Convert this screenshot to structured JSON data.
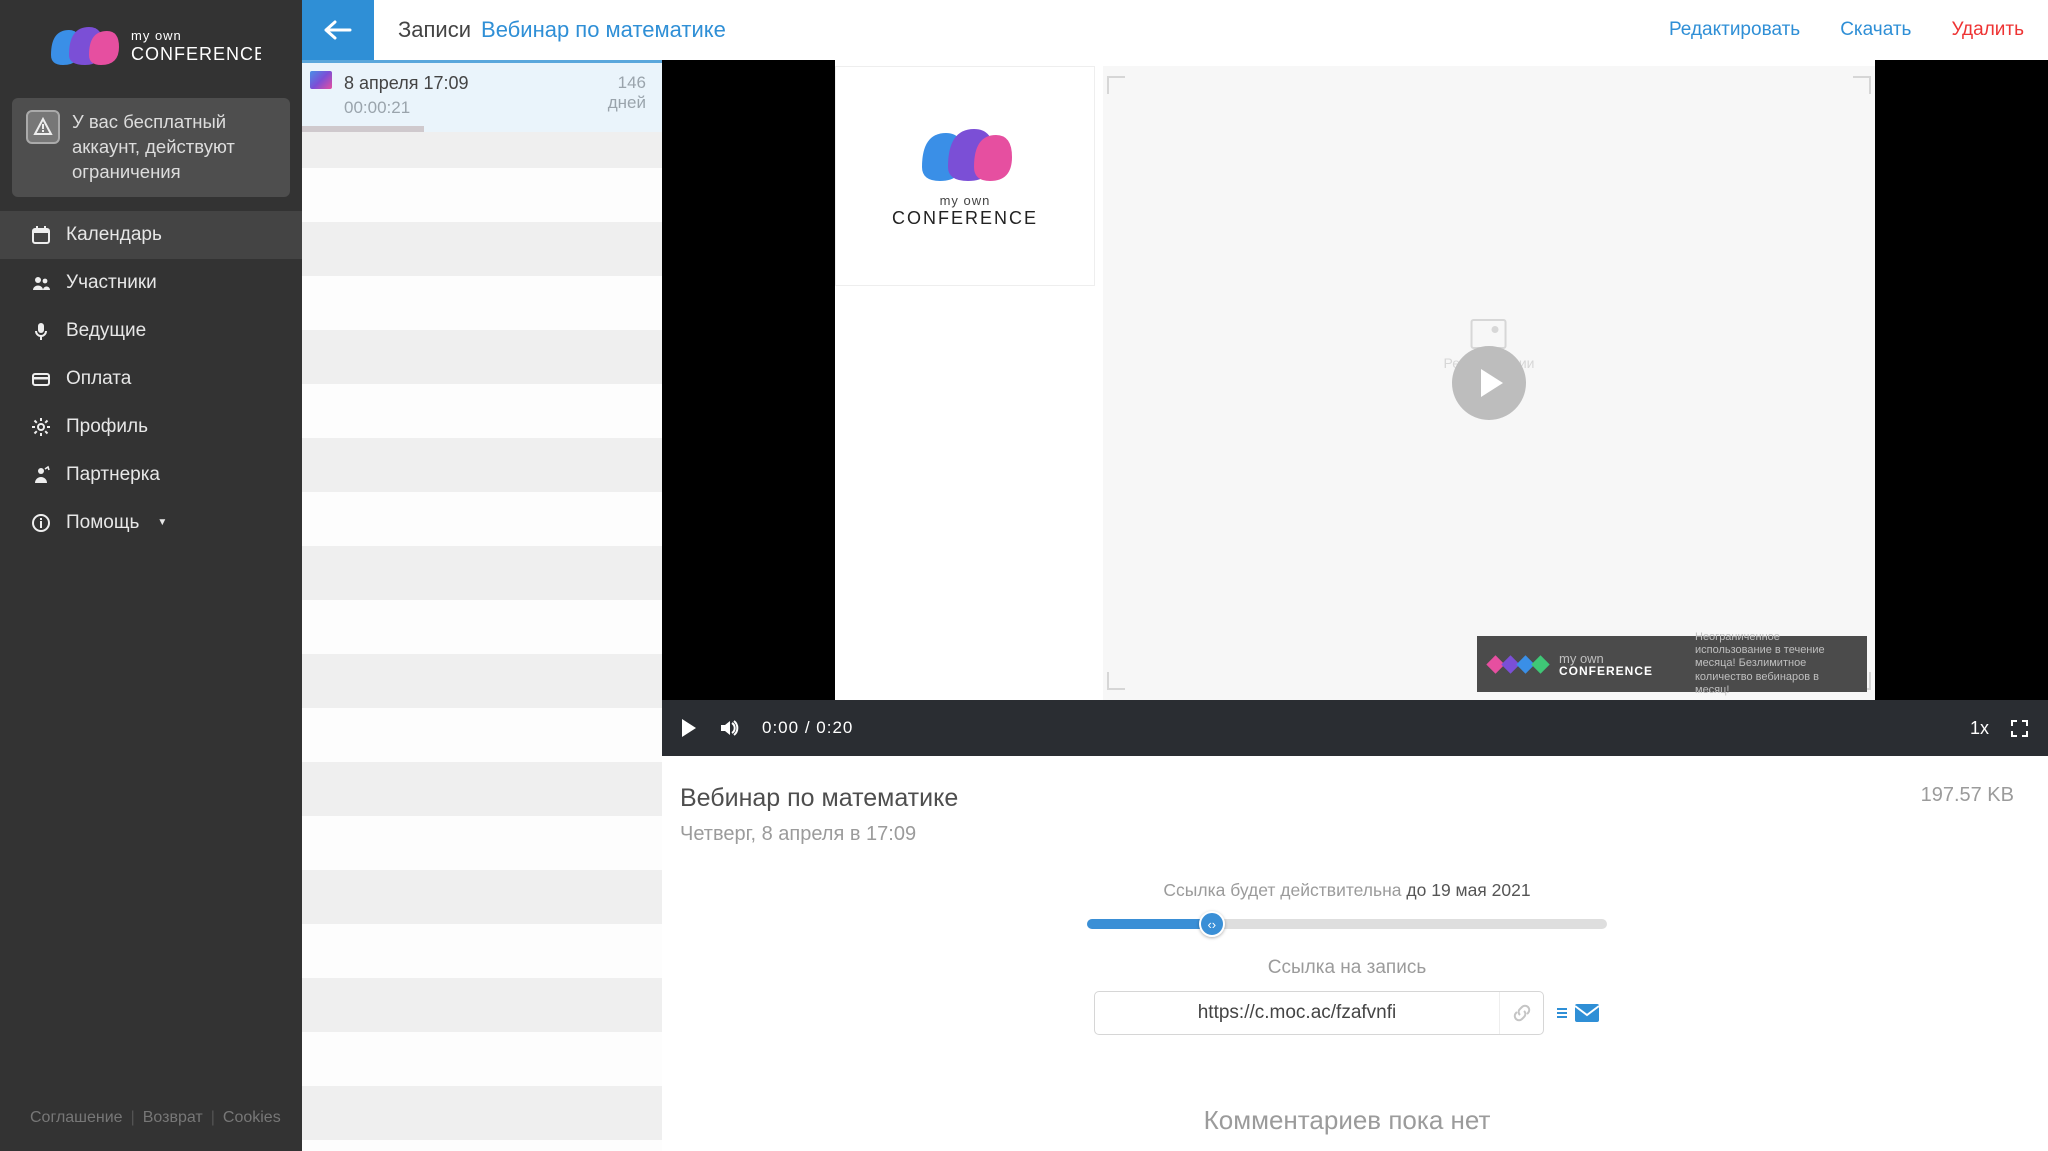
{
  "brand": {
    "line1": "my own",
    "line2": "CONFERENCE"
  },
  "notice": "У вас бесплатный аккаунт, действуют ограничения",
  "nav": {
    "calendar": "Календарь",
    "participants": "Участники",
    "hosts": "Ведущие",
    "payment": "Оплата",
    "profile": "Профиль",
    "affiliate": "Партнерка",
    "help": "Помощь"
  },
  "footer": {
    "agreement": "Соглашение",
    "refund": "Возврат",
    "cookies": "Cookies"
  },
  "crumb": {
    "label": "Записи",
    "link": "Вебинар по математике"
  },
  "actions": {
    "edit": "Редактировать",
    "download": "Скачать",
    "delete": "Удалить"
  },
  "listItem": {
    "date": "8 апреля 17:09",
    "duration": "00:00:21",
    "daysN": "146",
    "daysL": "дней"
  },
  "player": {
    "current": "0:00",
    "total": "0:20",
    "speed": "1x",
    "bannerL1": "my own",
    "bannerL2": "CONFERENCE",
    "bannerR": "Неограниченное использование в течение месяца! Безлимитное количество вебинаров в месяц!",
    "imgPh": "Режим студии"
  },
  "meta": {
    "title": "Вебинар по математике",
    "subtitle": "Четверг, 8 апреля в 17:09",
    "size": "197.57 KB"
  },
  "link": {
    "validPrefix": "Ссылка будет действительна ",
    "validBold": "до 19 мая 2021",
    "label": "Ссылка на запись",
    "url": "https://c.moc.ac/fzafvnfi",
    "sliderPercent": 24
  },
  "noComments": "Комментариев пока нет",
  "colors": {
    "accent": "#2f8fd6",
    "danger": "#e33"
  }
}
